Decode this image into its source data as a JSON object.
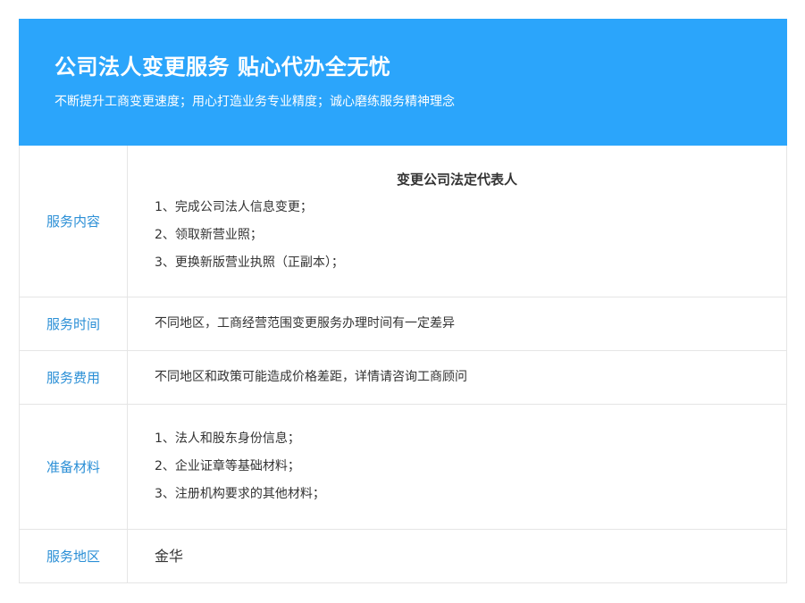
{
  "banner": {
    "title": "公司法人变更服务 贴心代办全无忧",
    "subtitle": "不断提升工商变更速度；用心打造业务专业精度；诚心磨练服务精神理念"
  },
  "rows": [
    {
      "label": "服务内容",
      "heading": "变更公司法定代表人",
      "lines": [
        "1、完成公司法人信息变更；",
        "2、领取新营业照；",
        "3、更换新版营业执照（正副本）；"
      ]
    },
    {
      "label": "服务时间",
      "lines": [
        "不同地区，工商经营范围变更服务办理时间有一定差异"
      ]
    },
    {
      "label": "服务费用",
      "lines": [
        "不同地区和政策可能造成价格差距，详情请咨询工商顾问"
      ]
    },
    {
      "label": "准备材料",
      "lines": [
        "1、法人和股东身份信息；",
        "2、企业证章等基础材料；",
        "3、注册机构要求的其他材料；"
      ]
    },
    {
      "label": "服务地区",
      "lines": [
        "金华"
      ]
    }
  ],
  "colors": {
    "banner_bg": "#2ba5fb",
    "label_text": "#2b8fd6",
    "border": "#e5e5e5"
  }
}
